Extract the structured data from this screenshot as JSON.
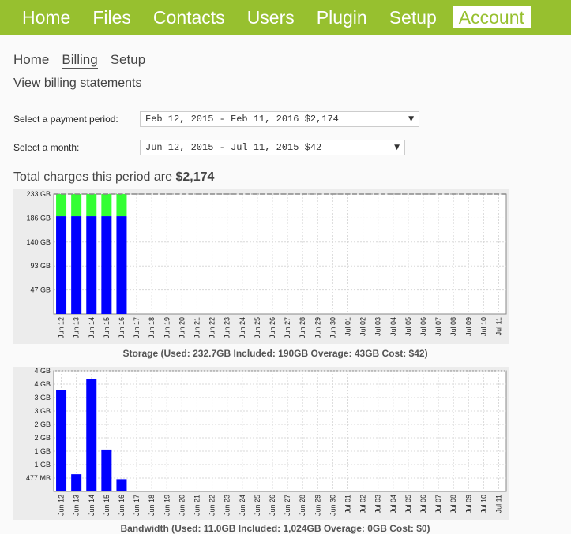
{
  "topnav": {
    "items": [
      {
        "label": "Home"
      },
      {
        "label": "Files"
      },
      {
        "label": "Contacts"
      },
      {
        "label": "Users"
      },
      {
        "label": "Plugin"
      },
      {
        "label": "Setup"
      },
      {
        "label": "Account"
      }
    ],
    "active": "Account"
  },
  "subnav": {
    "items": [
      {
        "label": "Home"
      },
      {
        "label": "Billing"
      },
      {
        "label": "Setup"
      }
    ],
    "active": "Billing"
  },
  "page": {
    "title": "View billing statements",
    "period_label": "Select a payment period:",
    "period_value": "Feb 12, 2015 - Feb 11, 2016 $2,174",
    "month_label": "Select a month:",
    "month_value": "Jun 12, 2015 - Jul 11, 2015 $42",
    "total_prefix": "Total charges this period are ",
    "total_value": "$2,174"
  },
  "colors": {
    "nav_bg": "#97c02f",
    "used": "#0000ff",
    "overage": "#33ff33",
    "included_line": "#888888"
  },
  "chart_data": [
    {
      "type": "bar",
      "stacked": true,
      "categories": [
        "Jun 12",
        "Jun 13",
        "Jun 14",
        "Jun 15",
        "Jun 16",
        "Jun 17",
        "Jun 18",
        "Jun 19",
        "Jun 20",
        "Jun 21",
        "Jun 22",
        "Jun 23",
        "Jun 24",
        "Jun 25",
        "Jun 26",
        "Jun 27",
        "Jun 28",
        "Jun 29",
        "Jun 30",
        "Jul 01",
        "Jul 02",
        "Jul 03",
        "Jul 04",
        "Jul 05",
        "Jul 06",
        "Jul 07",
        "Jul 08",
        "Jul 09",
        "Jul 10",
        "Jul 11"
      ],
      "series": [
        {
          "values": [
            190,
            190,
            190,
            190,
            190
          ]
        },
        {
          "values": [
            43,
            43,
            43,
            43,
            43
          ]
        }
      ],
      "yticks": [
        "47 GB",
        "93 GB",
        "140 GB",
        "186 GB",
        "233 GB"
      ],
      "ylim": [
        0,
        233
      ],
      "reference_line": 233,
      "grid": true,
      "caption": "Storage (Used: 232.7GB Included: 190GB Overage: 43GB Cost: $42)"
    },
    {
      "type": "bar",
      "categories": [
        "Jun 12",
        "Jun 13",
        "Jun 14",
        "Jun 15",
        "Jun 16",
        "Jun 17",
        "Jun 18",
        "Jun 19",
        "Jun 20",
        "Jun 21",
        "Jun 22",
        "Jun 23",
        "Jun 24",
        "Jun 25",
        "Jun 26",
        "Jun 27",
        "Jun 28",
        "Jun 29",
        "Jun 30",
        "Jul 01",
        "Jul 02",
        "Jul 03",
        "Jul 04",
        "Jul 05",
        "Jul 06",
        "Jul 07",
        "Jul 08",
        "Jul 09",
        "Jul 10",
        "Jul 11"
      ],
      "series": [
        {
          "values": [
            4.1,
            0.7,
            4.55,
            1.7,
            0.5
          ]
        }
      ],
      "yticks": [
        "477 MB",
        "1 GB",
        "1 GB",
        "2 GB",
        "2 GB",
        "3 GB",
        "3 GB",
        "4 GB",
        "4 GB"
      ],
      "ylim": [
        0,
        4.9
      ],
      "grid": true,
      "caption": "Bandwidth (Used: 11.0GB Included: 1,024GB Overage: 0GB Cost: $0)"
    }
  ]
}
